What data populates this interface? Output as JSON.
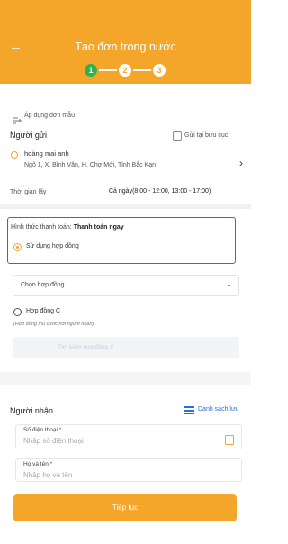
{
  "header": {
    "title": "Tạo đơn trong nước",
    "back_icon": "arrow-left-icon",
    "steps": [
      "1",
      "2",
      "3"
    ],
    "active_step": 1,
    "color": "#f4a62a",
    "active_color": "#2fb24c"
  },
  "template": {
    "label": "Áp dụng đơn mẫu",
    "icon": "template-add-icon"
  },
  "sender": {
    "section_title": "Người gửi",
    "send_at_post_office": "Gửi tại bưu cục",
    "name": "hoàng mai anh",
    "address": "Ngõ 1, X. Bình Văn, H. Chợ Mới, Tỉnh Bắc Kạn",
    "pickup_time_label": "Thời gian lấy",
    "pickup_time_value": "Cả ngày(8:00 - 12:00, 13:00 - 17:00)"
  },
  "payment": {
    "label": "Hình thức thanh toán:",
    "value": "Thanh toán ngay",
    "use_contract_label": "Sử dụng hợp đồng",
    "highlight_color": "#e0313a"
  },
  "contract": {
    "select_placeholder": "Chọn hợp đồng",
    "option_c": "Hợp đồng C",
    "option_c_note": "(Hợp đồng thu cước nơi người nhận)",
    "search_placeholder": "Tìm kiếm hợp đồng C"
  },
  "receiver": {
    "section_title": "Người nhận",
    "list_link": "Danh sách lưu",
    "phone_label": "Số điện thoại",
    "phone_placeholder": "Nhập số điện thoại",
    "name_label": "Họ và tên",
    "name_placeholder": "Nhập họ và tên",
    "required_mark": "*"
  },
  "continue_button": "Tiếp tục"
}
